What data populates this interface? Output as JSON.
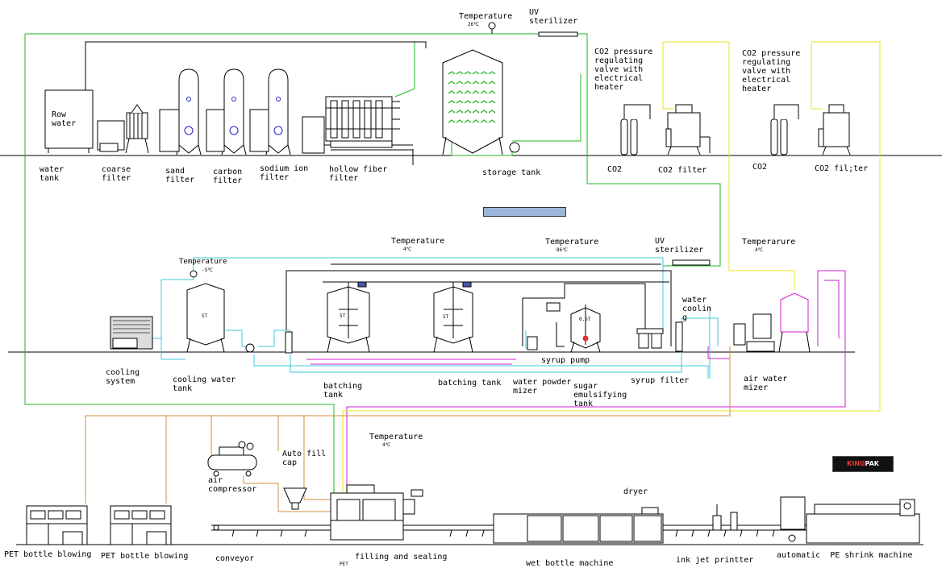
{
  "labels": {
    "row_water": "Row\nwater",
    "water_tank": "water\ntank",
    "coarse_filter": "coarse\nfilter",
    "sand_filter": "sand\nfilter",
    "carbon_filter": "carbon\nfilter",
    "sodium_ion_filter": "sodium ion\nfilter",
    "hollow_fiber_filter": "hollow fiber\nfilter",
    "storage_tank": "storage tank",
    "temp_top": "Temperature",
    "temp_top_val": "26℃",
    "uv_top": "UV\nsterilizer",
    "co2_valve_1": "CO2 pressure\nregulating\nvalve with\nelectrical\nheater",
    "co2_valve_2": "CO2 pressure\nregulating\nvalve with\nelectrical\nheater",
    "co2_1": "CO2",
    "co2_filter_1": "CO2 filter",
    "co2_2": "CO2",
    "co2_filter_2": "CO2 fil;ter",
    "temp_mid1": "Temperature",
    "temp_mid1_val": "4℃",
    "temp_mid2": "Temperature",
    "temp_mid2_val": "86℃",
    "uv_mid": "UV\nsterilizer",
    "temp_mid3": "Temperarure",
    "temp_mid3_val": "4℃",
    "temp_left": "Temperature",
    "temp_left_val": "-5℃",
    "cooling_system": "cooling\nsystem",
    "cooling_water_tank": "cooling water\ntank",
    "batching_tank_1": "batching\ntank",
    "batching_tank_2": "batching tank",
    "syrup_pump": "syrup pump",
    "water_powder_mizer": "water powder\nmizer",
    "sugar_emulsifying_tank": "sugar\nemulsifying\ntank",
    "syrup_filter": "syrup filter",
    "water_coolin": "water\ncoolin\ng",
    "air_water_mixer": "air water\nmizer",
    "tank_5t_1": "5T",
    "tank_5t_2": "5T",
    "tank_5t_3": "5T",
    "tank_0_5t": "0.5T",
    "temp_bottom": "Temperature",
    "temp_bottom_val": "4℃",
    "auto_fill_cap": "Auto fill\ncap",
    "air_compressor": "air\ncompressor",
    "dryer": "dryer",
    "pet_bottle_blowing_1": "PET bottle blowing",
    "pet_bottle_blowing_2": "PET bottle blowing",
    "conveyor": "conveyor",
    "filling_and_sealing": "filling and sealing",
    "pet_small": "PET",
    "wet_bottle_machine": "wet bottle machine",
    "ink_jet_printter": "ink jet printter",
    "automatic_pe_shrink": "automatic  PE shrink machine"
  },
  "logo": {
    "prefix": "KING",
    "suffix": "PAK"
  },
  "colors": {
    "green": "#22b422",
    "cyan": "#3cc8dc",
    "yellow": "#e6e61e",
    "magenta": "#d21ed2",
    "orange": "#d68c3c",
    "black": "#1a1a1a",
    "brand_red": "#e33333"
  }
}
